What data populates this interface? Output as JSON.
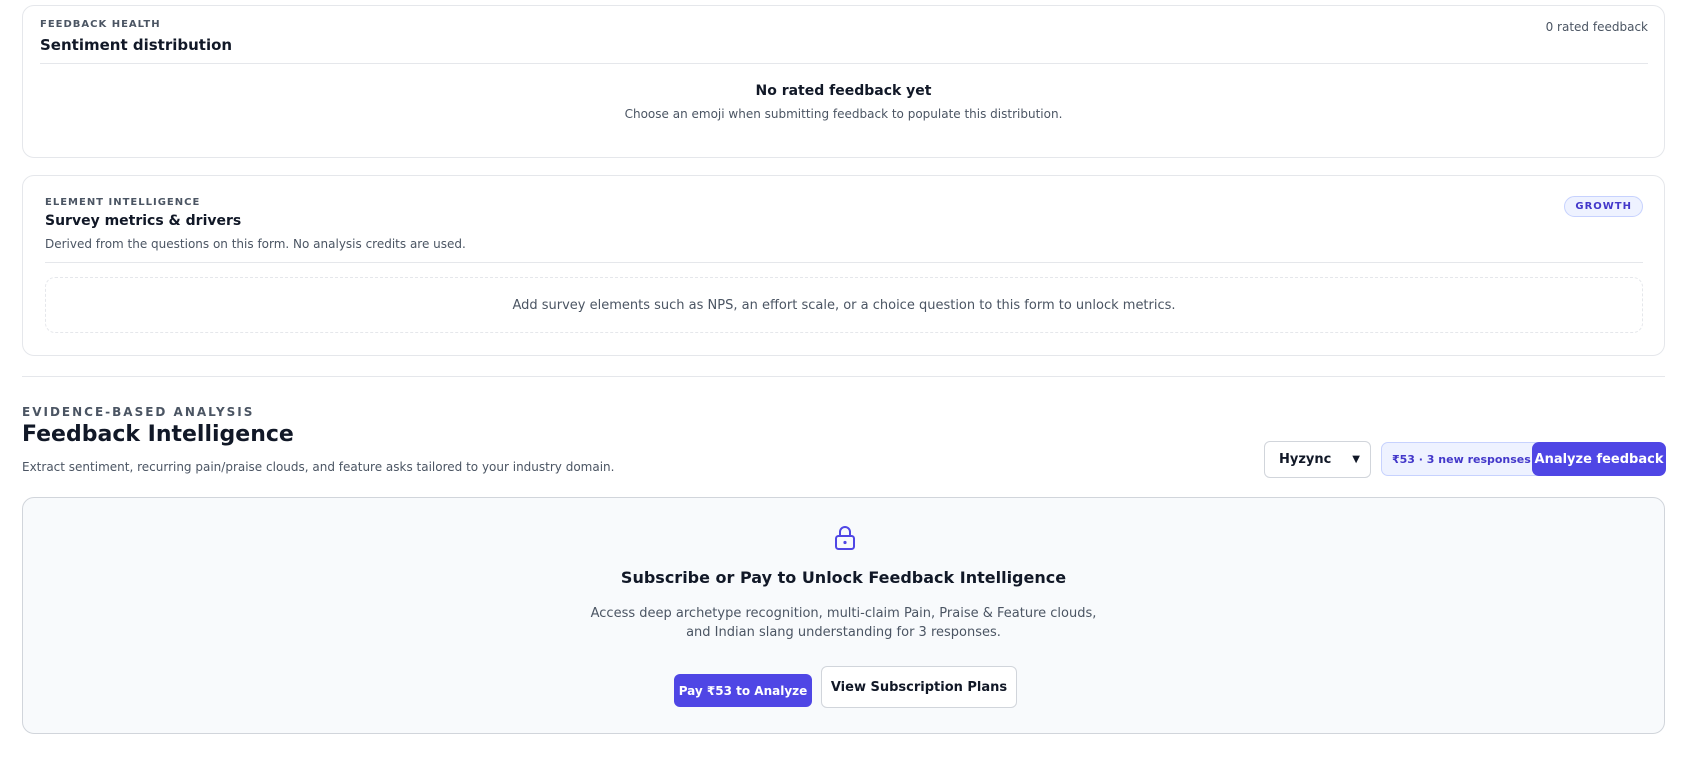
{
  "feedback_health": {
    "eyebrow": "FEEDBACK HEALTH",
    "title": "Sentiment distribution",
    "rated_count": "0 rated feedback",
    "empty_title": "No rated feedback yet",
    "empty_subtitle": "Choose an emoji when submitting feedback to populate this distribution."
  },
  "element_intelligence": {
    "eyebrow": "ELEMENT INTELLIGENCE",
    "title": "Survey metrics & drivers",
    "subtitle": "Derived from the questions on this form. No analysis credits are used.",
    "badge": "GROWTH",
    "empty_message": "Add survey elements such as NPS, an effort scale, or a choice question to this form to unlock metrics."
  },
  "feedback_intelligence": {
    "eyebrow": "EVIDENCE-BASED ANALYSIS",
    "title": "Feedback Intelligence",
    "subtitle": "Extract sentiment, recurring pain/praise clouds, and feature asks tailored to your industry domain.",
    "domain_select_value": "Hyzync",
    "credits_pill": "₹53 · 3 new responses",
    "analyze_button": "Analyze feedback",
    "lock": {
      "icon": "lock-icon",
      "title": "Subscribe or Pay to Unlock Feedback Intelligence",
      "description_line1": "Access deep archetype recognition, multi-claim Pain, Praise & Feature clouds,",
      "description_line2": "and Indian slang understanding for 3 responses.",
      "pay_button": "Pay ₹53 to Analyze",
      "plans_button": "View Subscription Plans"
    }
  },
  "colors": {
    "accent": "#4f46e5",
    "accent_soft": "#eef2ff",
    "border": "#e5e7eb",
    "muted_text": "#4b5563",
    "panel_bg": "#f8fafc"
  }
}
